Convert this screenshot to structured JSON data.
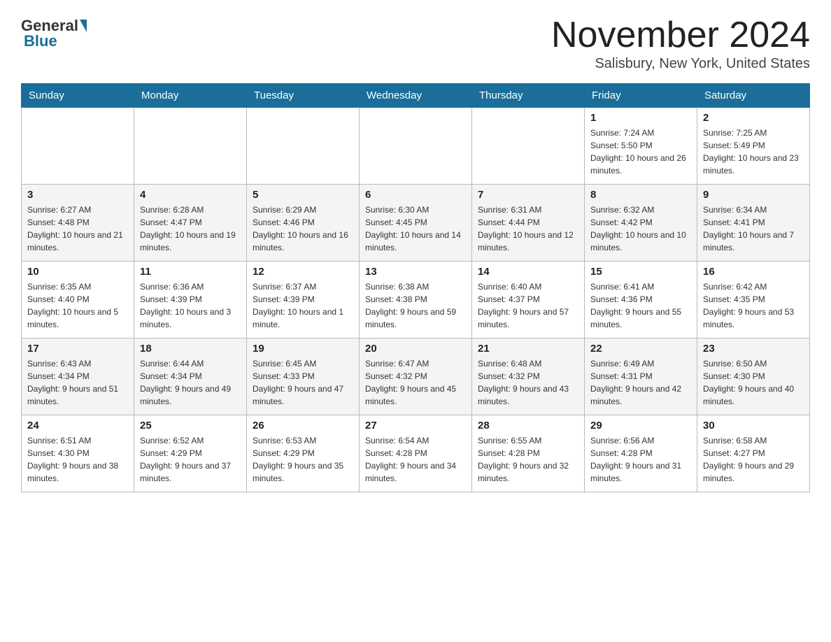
{
  "header": {
    "logo_general": "General",
    "logo_blue": "Blue",
    "month_title": "November 2024",
    "location": "Salisbury, New York, United States"
  },
  "weekdays": [
    "Sunday",
    "Monday",
    "Tuesday",
    "Wednesday",
    "Thursday",
    "Friday",
    "Saturday"
  ],
  "weeks": [
    [
      {
        "day": "",
        "sunrise": "",
        "sunset": "",
        "daylight": ""
      },
      {
        "day": "",
        "sunrise": "",
        "sunset": "",
        "daylight": ""
      },
      {
        "day": "",
        "sunrise": "",
        "sunset": "",
        "daylight": ""
      },
      {
        "day": "",
        "sunrise": "",
        "sunset": "",
        "daylight": ""
      },
      {
        "day": "",
        "sunrise": "",
        "sunset": "",
        "daylight": ""
      },
      {
        "day": "1",
        "sunrise": "Sunrise: 7:24 AM",
        "sunset": "Sunset: 5:50 PM",
        "daylight": "Daylight: 10 hours and 26 minutes."
      },
      {
        "day": "2",
        "sunrise": "Sunrise: 7:25 AM",
        "sunset": "Sunset: 5:49 PM",
        "daylight": "Daylight: 10 hours and 23 minutes."
      }
    ],
    [
      {
        "day": "3",
        "sunrise": "Sunrise: 6:27 AM",
        "sunset": "Sunset: 4:48 PM",
        "daylight": "Daylight: 10 hours and 21 minutes."
      },
      {
        "day": "4",
        "sunrise": "Sunrise: 6:28 AM",
        "sunset": "Sunset: 4:47 PM",
        "daylight": "Daylight: 10 hours and 19 minutes."
      },
      {
        "day": "5",
        "sunrise": "Sunrise: 6:29 AM",
        "sunset": "Sunset: 4:46 PM",
        "daylight": "Daylight: 10 hours and 16 minutes."
      },
      {
        "day": "6",
        "sunrise": "Sunrise: 6:30 AM",
        "sunset": "Sunset: 4:45 PM",
        "daylight": "Daylight: 10 hours and 14 minutes."
      },
      {
        "day": "7",
        "sunrise": "Sunrise: 6:31 AM",
        "sunset": "Sunset: 4:44 PM",
        "daylight": "Daylight: 10 hours and 12 minutes."
      },
      {
        "day": "8",
        "sunrise": "Sunrise: 6:32 AM",
        "sunset": "Sunset: 4:42 PM",
        "daylight": "Daylight: 10 hours and 10 minutes."
      },
      {
        "day": "9",
        "sunrise": "Sunrise: 6:34 AM",
        "sunset": "Sunset: 4:41 PM",
        "daylight": "Daylight: 10 hours and 7 minutes."
      }
    ],
    [
      {
        "day": "10",
        "sunrise": "Sunrise: 6:35 AM",
        "sunset": "Sunset: 4:40 PM",
        "daylight": "Daylight: 10 hours and 5 minutes."
      },
      {
        "day": "11",
        "sunrise": "Sunrise: 6:36 AM",
        "sunset": "Sunset: 4:39 PM",
        "daylight": "Daylight: 10 hours and 3 minutes."
      },
      {
        "day": "12",
        "sunrise": "Sunrise: 6:37 AM",
        "sunset": "Sunset: 4:39 PM",
        "daylight": "Daylight: 10 hours and 1 minute."
      },
      {
        "day": "13",
        "sunrise": "Sunrise: 6:38 AM",
        "sunset": "Sunset: 4:38 PM",
        "daylight": "Daylight: 9 hours and 59 minutes."
      },
      {
        "day": "14",
        "sunrise": "Sunrise: 6:40 AM",
        "sunset": "Sunset: 4:37 PM",
        "daylight": "Daylight: 9 hours and 57 minutes."
      },
      {
        "day": "15",
        "sunrise": "Sunrise: 6:41 AM",
        "sunset": "Sunset: 4:36 PM",
        "daylight": "Daylight: 9 hours and 55 minutes."
      },
      {
        "day": "16",
        "sunrise": "Sunrise: 6:42 AM",
        "sunset": "Sunset: 4:35 PM",
        "daylight": "Daylight: 9 hours and 53 minutes."
      }
    ],
    [
      {
        "day": "17",
        "sunrise": "Sunrise: 6:43 AM",
        "sunset": "Sunset: 4:34 PM",
        "daylight": "Daylight: 9 hours and 51 minutes."
      },
      {
        "day": "18",
        "sunrise": "Sunrise: 6:44 AM",
        "sunset": "Sunset: 4:34 PM",
        "daylight": "Daylight: 9 hours and 49 minutes."
      },
      {
        "day": "19",
        "sunrise": "Sunrise: 6:45 AM",
        "sunset": "Sunset: 4:33 PM",
        "daylight": "Daylight: 9 hours and 47 minutes."
      },
      {
        "day": "20",
        "sunrise": "Sunrise: 6:47 AM",
        "sunset": "Sunset: 4:32 PM",
        "daylight": "Daylight: 9 hours and 45 minutes."
      },
      {
        "day": "21",
        "sunrise": "Sunrise: 6:48 AM",
        "sunset": "Sunset: 4:32 PM",
        "daylight": "Daylight: 9 hours and 43 minutes."
      },
      {
        "day": "22",
        "sunrise": "Sunrise: 6:49 AM",
        "sunset": "Sunset: 4:31 PM",
        "daylight": "Daylight: 9 hours and 42 minutes."
      },
      {
        "day": "23",
        "sunrise": "Sunrise: 6:50 AM",
        "sunset": "Sunset: 4:30 PM",
        "daylight": "Daylight: 9 hours and 40 minutes."
      }
    ],
    [
      {
        "day": "24",
        "sunrise": "Sunrise: 6:51 AM",
        "sunset": "Sunset: 4:30 PM",
        "daylight": "Daylight: 9 hours and 38 minutes."
      },
      {
        "day": "25",
        "sunrise": "Sunrise: 6:52 AM",
        "sunset": "Sunset: 4:29 PM",
        "daylight": "Daylight: 9 hours and 37 minutes."
      },
      {
        "day": "26",
        "sunrise": "Sunrise: 6:53 AM",
        "sunset": "Sunset: 4:29 PM",
        "daylight": "Daylight: 9 hours and 35 minutes."
      },
      {
        "day": "27",
        "sunrise": "Sunrise: 6:54 AM",
        "sunset": "Sunset: 4:28 PM",
        "daylight": "Daylight: 9 hours and 34 minutes."
      },
      {
        "day": "28",
        "sunrise": "Sunrise: 6:55 AM",
        "sunset": "Sunset: 4:28 PM",
        "daylight": "Daylight: 9 hours and 32 minutes."
      },
      {
        "day": "29",
        "sunrise": "Sunrise: 6:56 AM",
        "sunset": "Sunset: 4:28 PM",
        "daylight": "Daylight: 9 hours and 31 minutes."
      },
      {
        "day": "30",
        "sunrise": "Sunrise: 6:58 AM",
        "sunset": "Sunset: 4:27 PM",
        "daylight": "Daylight: 9 hours and 29 minutes."
      }
    ]
  ]
}
